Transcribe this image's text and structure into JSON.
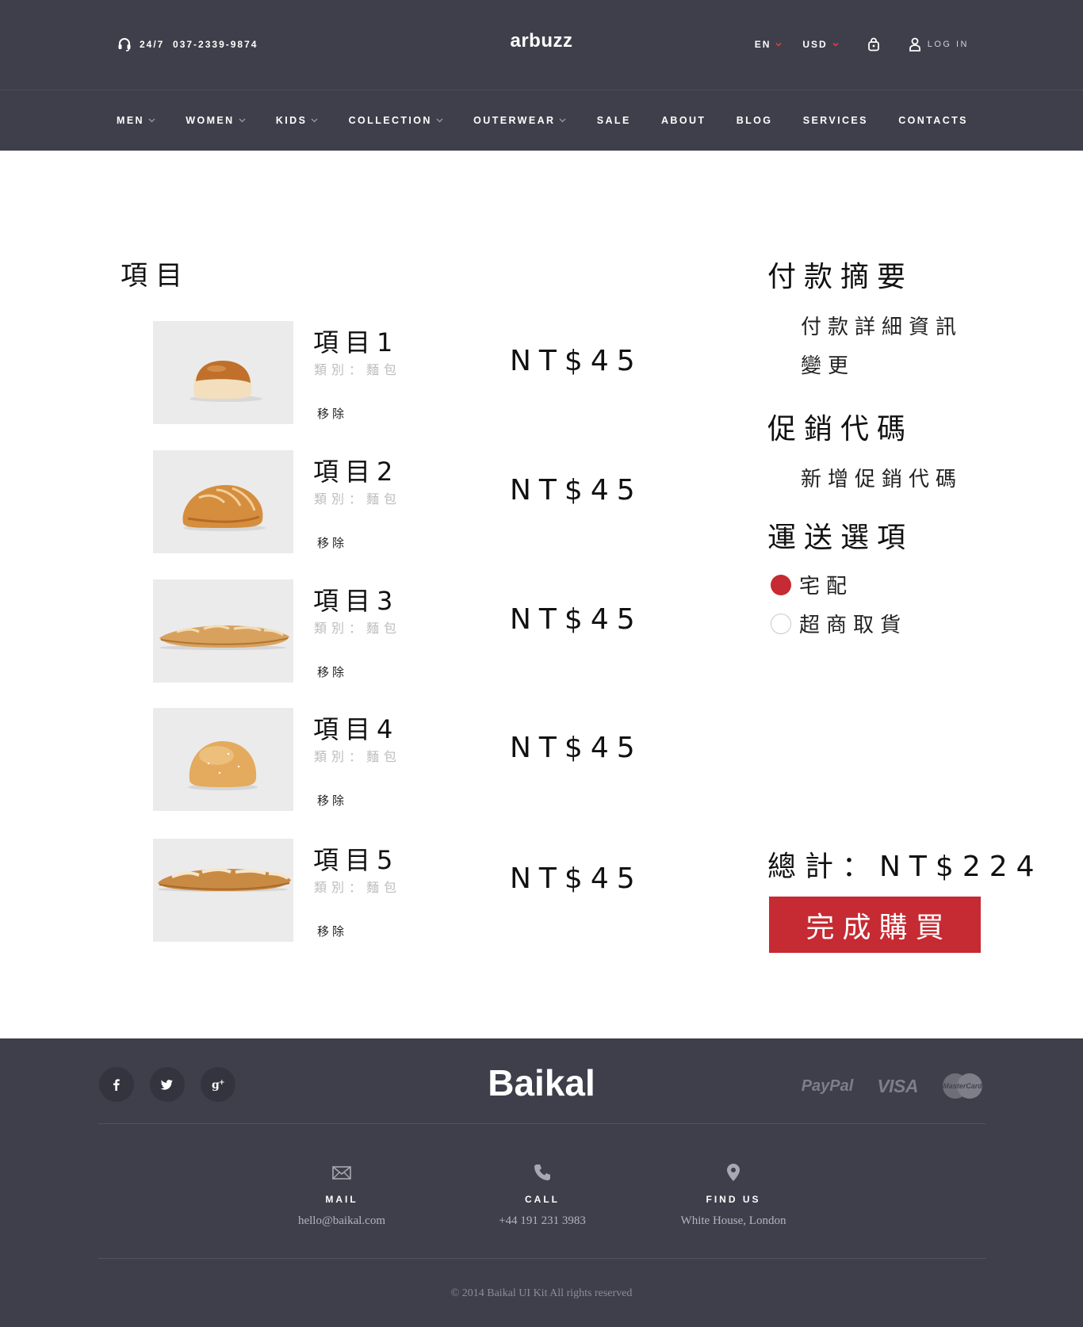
{
  "header": {
    "phone": "24/7  037-2339-9874",
    "brand": "arbuzz",
    "language": "EN",
    "currency": "USD",
    "login": "LOG IN",
    "accent_color": "#e03c3c",
    "bg_color": "#3f3f4b"
  },
  "nav": [
    {
      "label": "MEN",
      "has_dropdown": true
    },
    {
      "label": "WOMEN",
      "has_dropdown": true
    },
    {
      "label": "KIDS",
      "has_dropdown": true
    },
    {
      "label": "COLLECTION",
      "has_dropdown": true
    },
    {
      "label": "OUTERWEAR",
      "has_dropdown": true
    },
    {
      "label": "SALE",
      "has_dropdown": false
    },
    {
      "label": "ABOUT",
      "has_dropdown": false
    },
    {
      "label": "BLOG",
      "has_dropdown": false
    },
    {
      "label": "SERVICES",
      "has_dropdown": false
    },
    {
      "label": "CONTACTS",
      "has_dropdown": false
    }
  ],
  "cart": {
    "heading": "項目",
    "items": [
      {
        "name": "項目1",
        "category": "類別：麵包",
        "remove": "移除",
        "price": "NT$45",
        "image": "bread-roll"
      },
      {
        "name": "項目2",
        "category": "類別：麵包",
        "remove": "移除",
        "price": "NT$45",
        "image": "crusty-roll"
      },
      {
        "name": "項目3",
        "category": "類別：麵包",
        "remove": "移除",
        "price": "NT$45",
        "image": "baguette"
      },
      {
        "name": "項目4",
        "category": "類別：麵包",
        "remove": "移除",
        "price": "NT$45",
        "image": "round-bun"
      },
      {
        "name": "項目5",
        "category": "類別：麵包",
        "remove": "移除",
        "price": "NT$45",
        "image": "baguette-floured"
      }
    ]
  },
  "summary": {
    "payment_heading": "付款摘要",
    "payment_details": "付款詳細資訊",
    "payment_change": "變更",
    "promo_heading": "促銷代碼",
    "promo_add": "新增促銷代碼",
    "shipping_heading": "運送選項",
    "shipping_options": [
      {
        "label": "宅配",
        "selected": true
      },
      {
        "label": "超商取貨",
        "selected": false
      }
    ],
    "total": "總計：NT$224",
    "buy_button": "完成購買",
    "button_color": "#c62a32"
  },
  "footer": {
    "brand": "Baikal",
    "social": [
      "facebook-icon",
      "twitter-icon",
      "google-plus-icon"
    ],
    "payments": {
      "paypal": "PayPal",
      "visa": "VISA",
      "mastercard": "MasterCard"
    },
    "contacts": [
      {
        "icon": "mail-icon",
        "label": "MAIL",
        "value": "hello@baikal.com"
      },
      {
        "icon": "phone-icon",
        "label": "CALL",
        "value": "+44 191 231 3983"
      },
      {
        "icon": "location-pin-icon",
        "label": "FIND US",
        "value": "White House, London"
      }
    ],
    "copyright": "© 2014 Baikal UI Kit All rights reserved"
  }
}
